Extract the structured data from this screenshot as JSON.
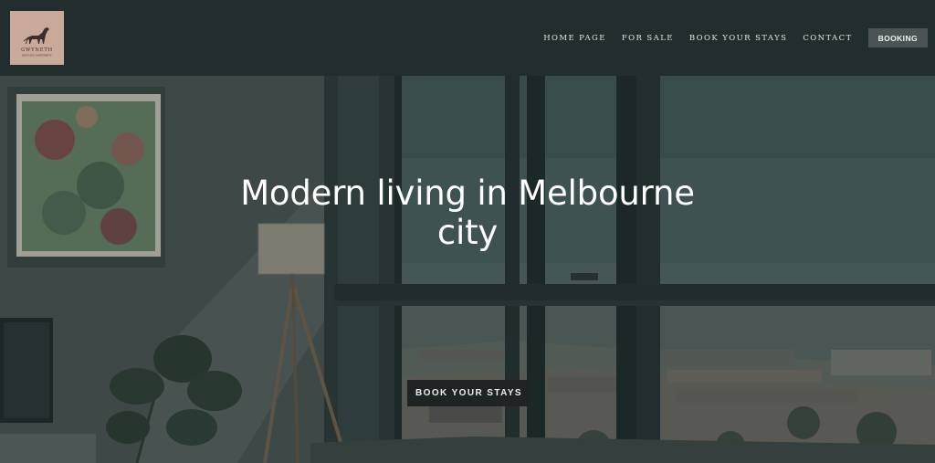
{
  "brand": {
    "logo_name": "GWYNETH",
    "logo_tagline": "BOUTIQUE APARTMENTS",
    "logo_color": "#c9a99a"
  },
  "nav": {
    "items": [
      {
        "label": "HOME PAGE"
      },
      {
        "label": "FOR SALE"
      },
      {
        "label": "BOOK YOUR STAYS"
      },
      {
        "label": "CONTACT"
      }
    ],
    "booking_label": "BOOKING"
  },
  "hero": {
    "title_line1": "Modern living in Melbourne",
    "title_line2": "city",
    "cta_label": "BOOK YOUR STAYS"
  },
  "colors": {
    "header_bg": "#222d2d",
    "booking_bg": "#4b5354",
    "cta_bg": "#1e2424"
  }
}
